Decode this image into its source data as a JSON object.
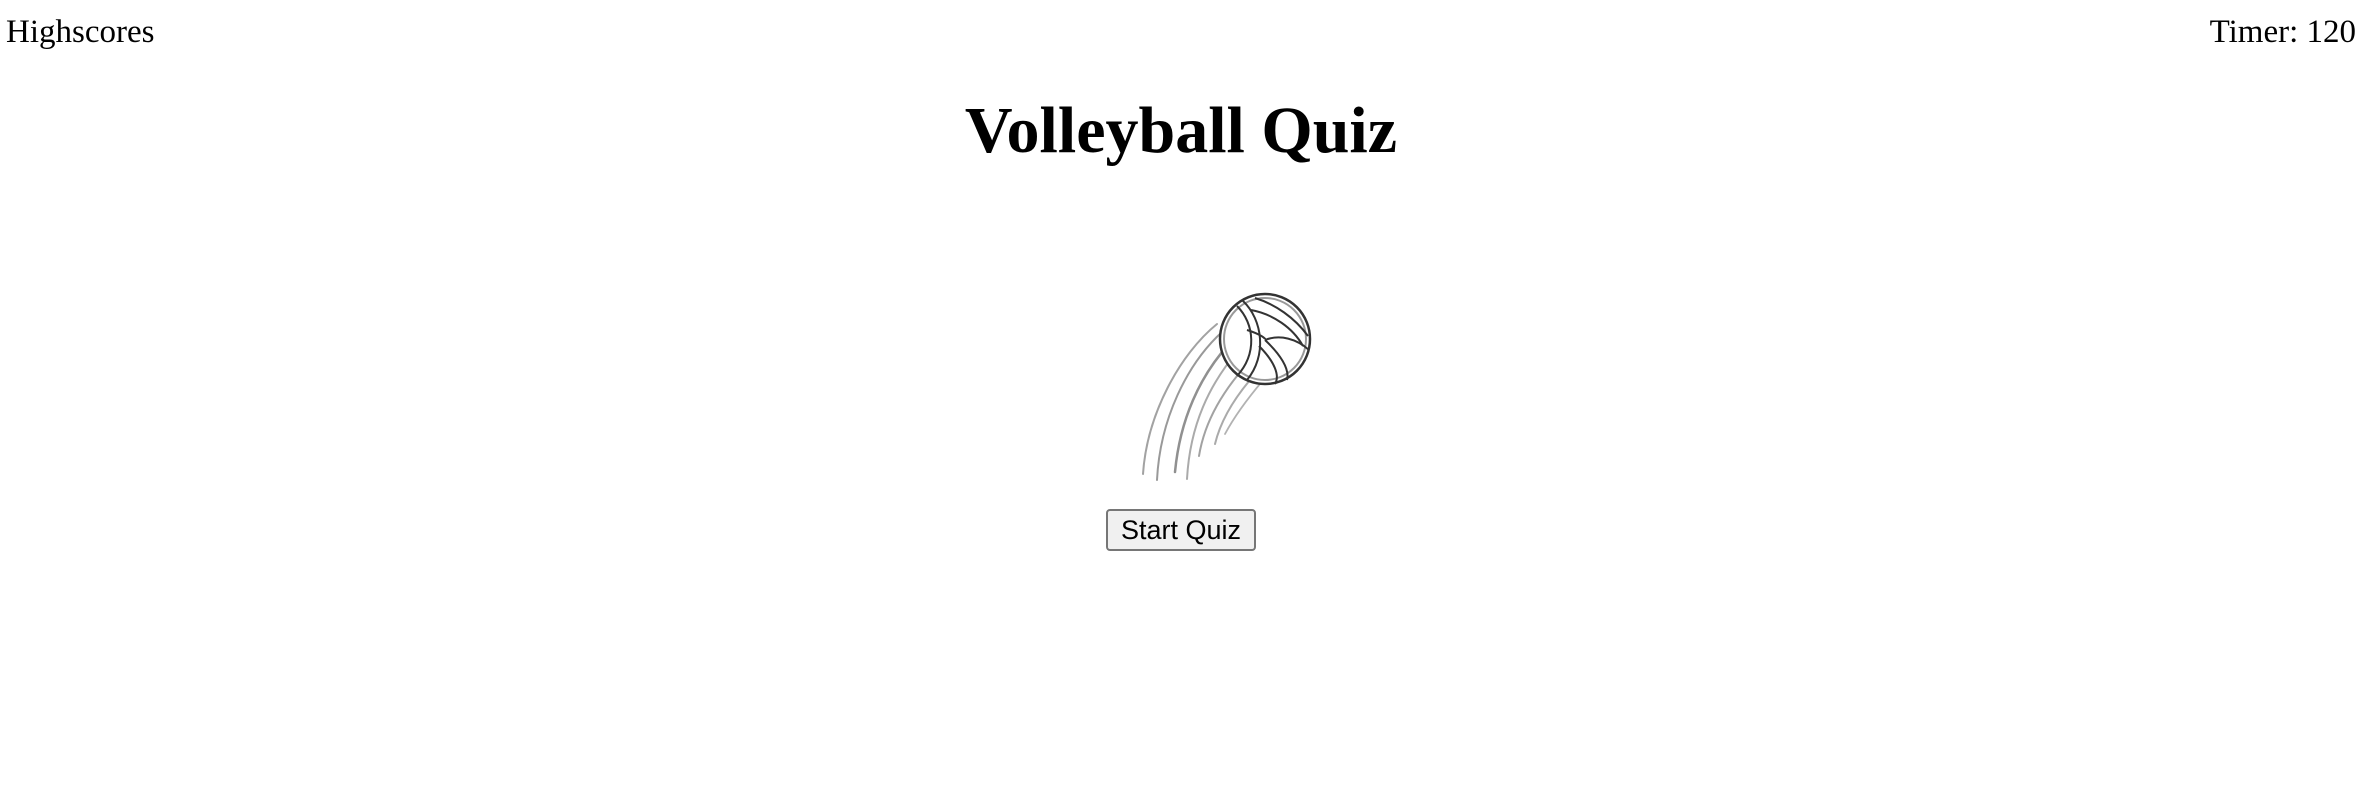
{
  "header": {
    "highscores_label": "Highscores",
    "timer_text": "Timer: 120"
  },
  "main": {
    "title": "Volleyball Quiz",
    "image_icon": "volleyball-in-motion-icon",
    "start_button_label": "Start Quiz"
  },
  "colors": {
    "background": "#ffffff",
    "text": "#000000",
    "button_background": "#f0f0f0",
    "button_border": "#767676"
  }
}
